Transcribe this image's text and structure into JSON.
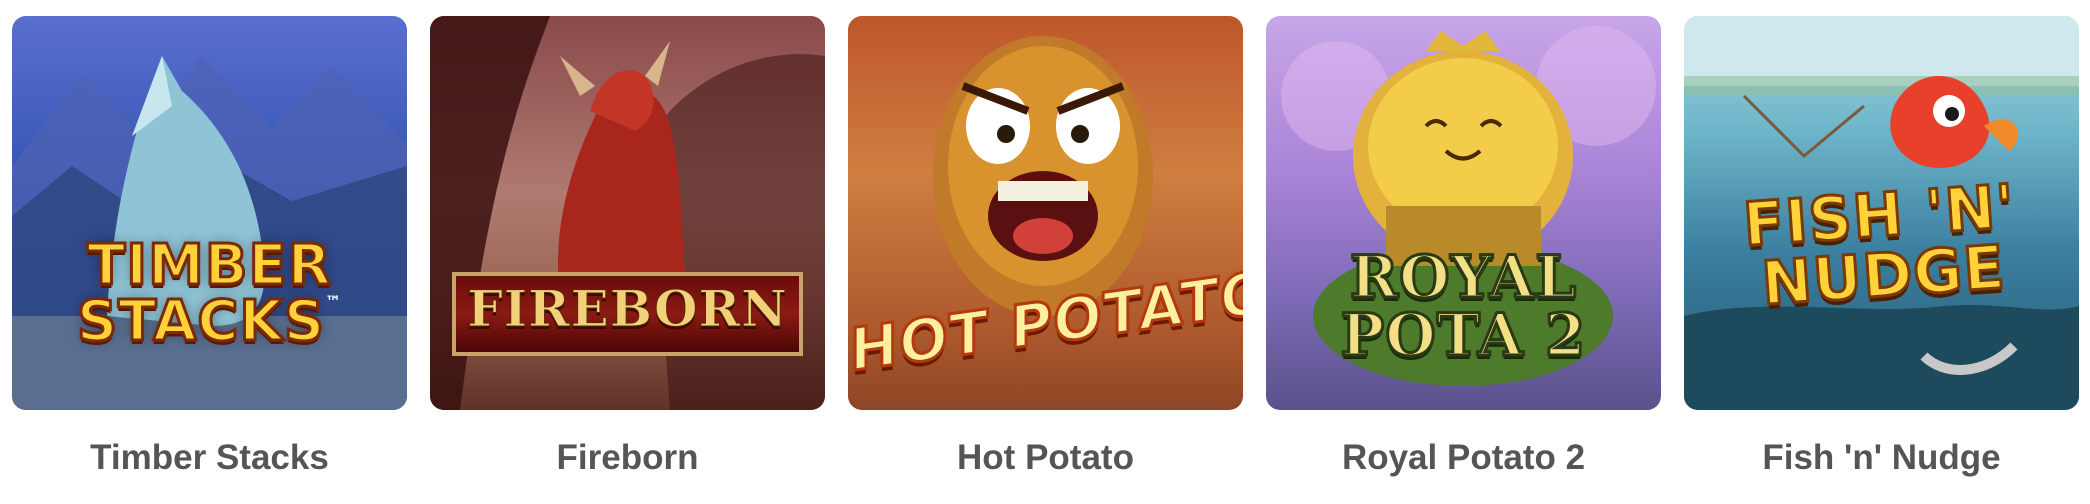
{
  "games": [
    {
      "title": "Timber Stacks",
      "logo_lines": [
        "TIMBER",
        "STACKS"
      ],
      "tm": "™",
      "image_icon": "howling-wolf-icon",
      "accent": "#3c5ab8"
    },
    {
      "title": "Fireborn",
      "logo_lines": [
        "FIREBORN"
      ],
      "image_icon": "red-dragon-icon",
      "accent": "#8a4a4a"
    },
    {
      "title": "Hot Potato",
      "logo_lines": [
        "HOT POTATO!"
      ],
      "image_icon": "angry-potato-icon",
      "accent": "#c0522a"
    },
    {
      "title": "Royal Potato 2",
      "logo_lines": [
        "ROYAL",
        "POTA 2"
      ],
      "image_icon": "crowned-potato-icon",
      "accent": "#a983d6"
    },
    {
      "title": "Fish 'n' Nudge",
      "logo_lines": [
        "FISH 'N'",
        "NUDGE"
      ],
      "image_icon": "goldfish-icon",
      "accent": "#6cb4c8"
    }
  ]
}
